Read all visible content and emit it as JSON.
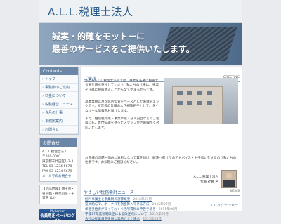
{
  "header": {
    "logo": "A.L.L.税理士法人"
  },
  "banner": {
    "line1": "誠実・的確をモットーに",
    "line2": "最善のサービスをご提供いたします。"
  },
  "sidebar": {
    "contents_title": "Contents",
    "items": [
      {
        "label": "トップ"
      },
      {
        "label": "事務所のご案内"
      },
      {
        "label": "料金について"
      },
      {
        "label": "税務経営ニュース"
      },
      {
        "label": "今月の仕事"
      },
      {
        "label": "事務所案内"
      },
      {
        "label": "お問合せ"
      }
    ],
    "contact_title": "お問合せ",
    "contact_lines": [
      "A.L.L.税理士法人",
      "〒100-0001",
      "東京都千代田区1-2-3",
      "TEL 03-1234-5678",
      "FAX 03-1234-5679"
    ],
    "contact_link": "メールでのお問合せ",
    "area_text": "【対応地域】埼玉県・東京都・神奈川県・千葉県 ほか",
    "badge_line1": "MyKomon",
    "badge_line2": "会員専用ページログイン"
  },
  "main": {
    "greeting_title": "ご挨拶",
    "greeting_tag": "GREETING",
    "para1": "私たちA.L.L.税理士法人では、事業を正確に把握する事を最も重視しています。私たちの仕事は、事業を正確に把握することから全て始まるからです。",
    "para2": "基本業務は月次巡回監査をベースとした帳簿チェックです。経営者の皆様のよき相談相手として、タイムリーな情報をお届けします。",
    "para3": "また、相続税対策・事業承継・法人設立などのご相談にも、専門知識を持ったスタッフがきめ細かく対応いたします。",
    "para4": "お客様の問題・悩みに真剣になって耳を傾け、解決へ向けてのアドバイス・お手伝いをするのが私たちの仕事です。お気軽にご相談ください。",
    "sign_company": "A.L.L.税理士法人",
    "sign_name": "代表 社員 名",
    "news_title": "やさしい税務会計ニュース",
    "news_tag": "NEWS",
    "news": [
      {
        "title": "個人事業主と事業税の計算概要",
        "date": "2015年07月"
      },
      {
        "title": "役員給与で、ボーナスを損金算入できる方法",
        "date": "2015年07月"
      },
      {
        "title": "年金受給者が知っておくべき所得税の申告手続き",
        "date": "2015年06月"
      },
      {
        "title": "平成27年度税制改正による改正点について",
        "date": "2015年06月"
      },
      {
        "title": "会社の従業員を役員に昇格させた場合",
        "date": "2015年05月"
      }
    ],
    "backnumber": "» バックナンバー"
  }
}
